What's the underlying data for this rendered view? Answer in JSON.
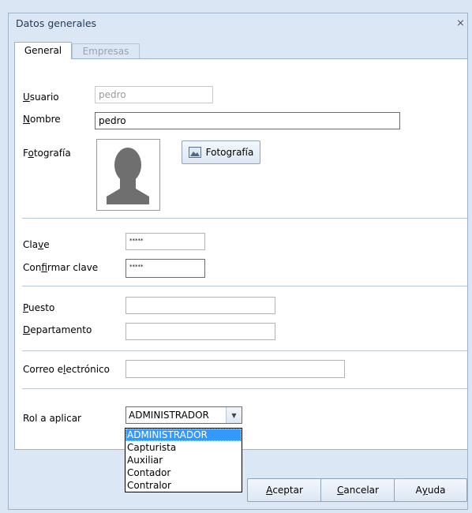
{
  "window": {
    "title": "Datos generales",
    "close_glyph": "⨯"
  },
  "tabs": [
    {
      "label": "General"
    },
    {
      "label": "Empresas"
    }
  ],
  "form": {
    "usuario": {
      "label_u": "U",
      "label_rest": "suario",
      "value": "pedro"
    },
    "nombre": {
      "label_u": "N",
      "label_rest": "ombre",
      "value": "pedro"
    },
    "fotografia": {
      "label_pre": "F",
      "label_u": "o",
      "label_rest": "tografía",
      "button": "Fotografía"
    },
    "clave": {
      "label_pre": "Cla",
      "label_u": "v",
      "label_rest": "e",
      "value": "*****"
    },
    "confirmar": {
      "label_pre": "Con",
      "label_u": "f",
      "label_rest": "irmar clave",
      "value": "*****"
    },
    "puesto": {
      "label_u": "P",
      "label_rest": "uesto",
      "value": ""
    },
    "departamento": {
      "label_u": "D",
      "label_rest": "epartamento",
      "value": ""
    },
    "correo": {
      "label_pre": "Correo e",
      "label_u": "l",
      "label_rest": "ectrónico",
      "value": ""
    },
    "rol": {
      "label": "Rol a aplicar",
      "selected": "ADMINISTRADOR",
      "options": [
        "ADMINISTRADOR",
        "Capturista",
        "Auxiliar",
        "Contador",
        "Contralor"
      ]
    }
  },
  "buttons": {
    "aceptar": {
      "u": "A",
      "rest": "ceptar"
    },
    "cancelar": {
      "u": "C",
      "rest": "ancelar"
    },
    "ayuda": {
      "pre": "A",
      "u": "y",
      "rest": "uda"
    }
  }
}
